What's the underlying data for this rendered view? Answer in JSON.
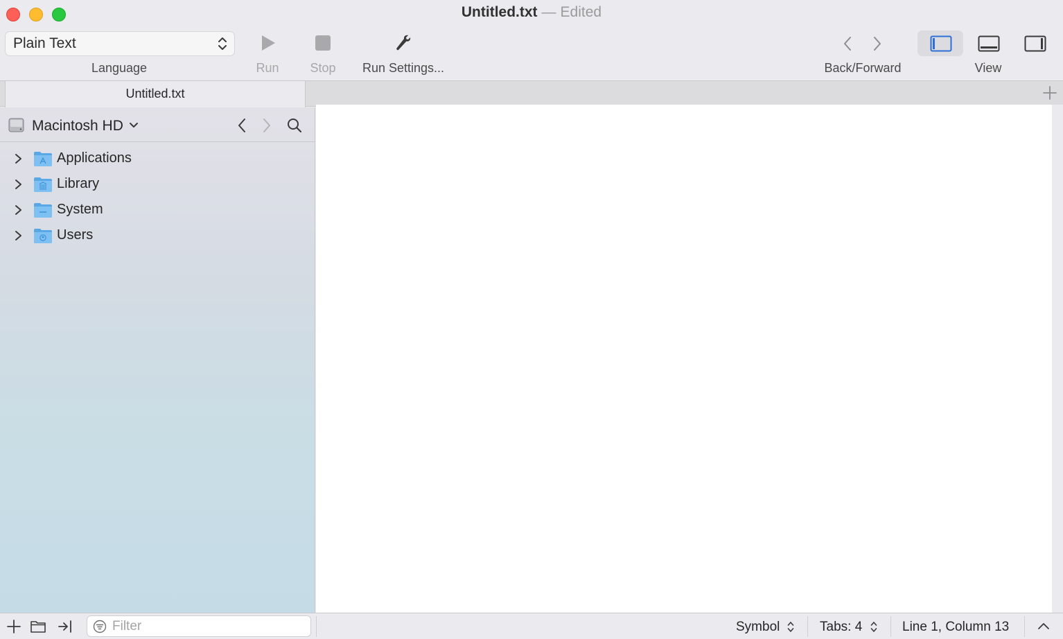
{
  "window": {
    "file_name": "Untitled.txt",
    "separator": "—",
    "status": "Edited"
  },
  "toolbar": {
    "language": {
      "value": "Plain Text",
      "label": "Language"
    },
    "run": {
      "label": "Run",
      "icon": "play-icon",
      "enabled": false
    },
    "stop": {
      "label": "Stop",
      "icon": "stop-icon",
      "enabled": false
    },
    "run_settings": {
      "label": "Run Settings...",
      "icon": "wrench-icon"
    },
    "back_forward": {
      "label": "Back/Forward"
    },
    "view": {
      "label": "View",
      "active_mode": "left-sidebar"
    }
  },
  "tabs": [
    {
      "label": "Untitled.txt",
      "active": true
    }
  ],
  "sidebar": {
    "location": "Macintosh HD",
    "items": [
      {
        "label": "Applications",
        "icon": "applications-folder-icon"
      },
      {
        "label": "Library",
        "icon": "library-folder-icon"
      },
      {
        "label": "System",
        "icon": "system-folder-icon"
      },
      {
        "label": "Users",
        "icon": "users-folder-icon"
      }
    ]
  },
  "statusbar": {
    "filter_placeholder": "Filter",
    "symbol": "Symbol",
    "tabs": "Tabs: 4",
    "position": "Line 1, Column 13"
  },
  "colors": {
    "accent": "#2d6fd6",
    "folder": "#6eb6ee",
    "close": "#fe5f57",
    "minimize": "#febc2e",
    "maximize": "#28c840"
  }
}
